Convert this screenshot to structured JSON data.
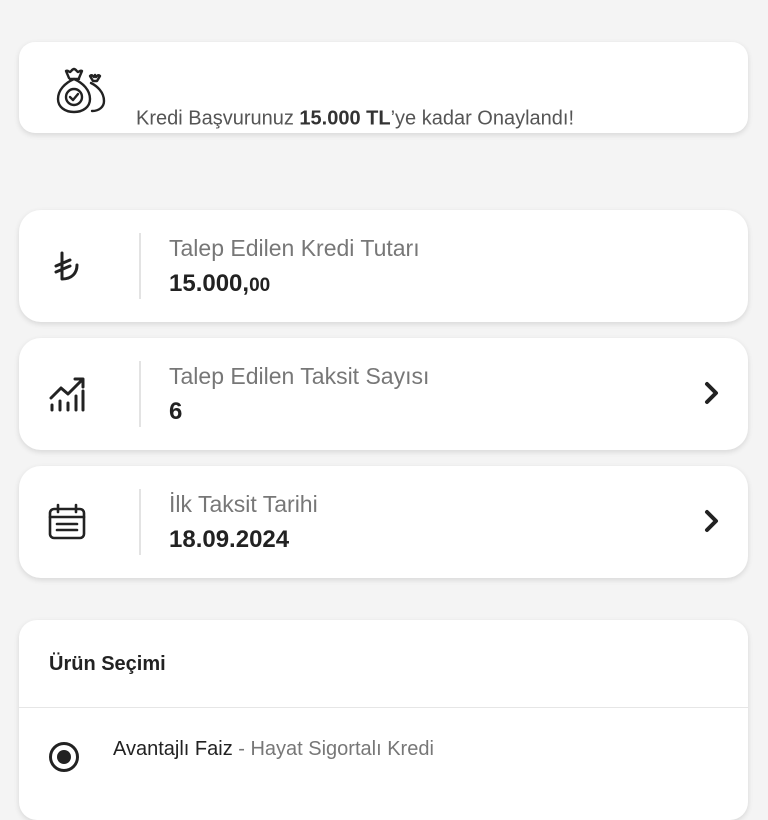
{
  "banner": {
    "icon": "money-bags-check-icon",
    "text_before": "Kredi Başvurunuz ",
    "amount": "15.000 TL",
    "text_after": "’ye kadar Onaylandı!"
  },
  "fields": [
    {
      "icon": "lira-icon",
      "label": "Talep Edilen Kredi Tutarı",
      "value_main": "15.000,",
      "value_decimal": "00",
      "has_chevron": false
    },
    {
      "icon": "growth-chart-icon",
      "label": "Talep Edilen Taksit Sayısı",
      "value": "6",
      "has_chevron": true
    },
    {
      "icon": "calendar-icon",
      "label": "İlk Taksit Tarihi",
      "value": "18.09.2024",
      "has_chevron": true
    }
  ],
  "product": {
    "title": "Ürün Seçimi",
    "option_main": "Avantajlı Faiz",
    "option_sep": " - ",
    "option_sub": "Hayat Sigortalı Kredi",
    "selected": true
  }
}
